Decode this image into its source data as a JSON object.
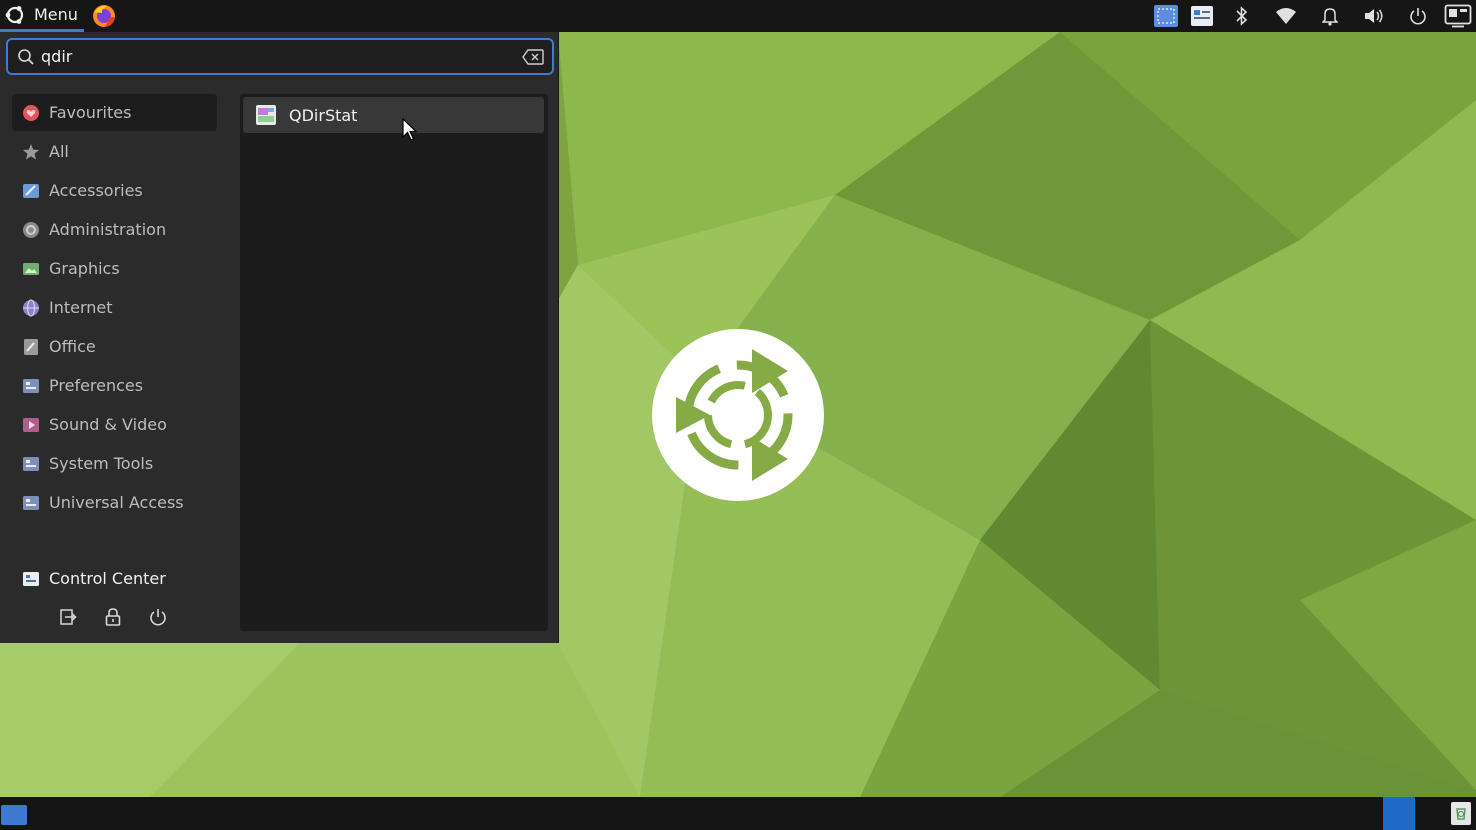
{
  "panel": {
    "menu_label": "Menu",
    "icons": {
      "menu": "ubuntu-mate-icon",
      "launcher": "firefox-icon",
      "tray": [
        "screenshot-icon",
        "control-center-icon",
        "bluetooth-icon",
        "wifi-icon",
        "notification-bell-icon",
        "volume-icon",
        "power-icon",
        "display-icon"
      ]
    }
  },
  "search": {
    "value": "qdir",
    "placeholder": "",
    "icon": "search-icon",
    "clear_icon": "backspace-clear-icon"
  },
  "categories": [
    {
      "label": "Favourites",
      "icon": "heart-icon",
      "color": "#e8525c"
    },
    {
      "label": "All",
      "icon": "star-icon",
      "color": "#9a9a9a"
    },
    {
      "label": "Accessories",
      "icon": "accessories-icon",
      "color": "#6a9bd8"
    },
    {
      "label": "Administration",
      "icon": "administration-icon",
      "color": "#8a8a8a"
    },
    {
      "label": "Graphics",
      "icon": "graphics-icon",
      "color": "#6fae6f"
    },
    {
      "label": "Internet",
      "icon": "internet-globe-icon",
      "color": "#8d82c8"
    },
    {
      "label": "Office",
      "icon": "office-icon",
      "color": "#9a9a9a"
    },
    {
      "label": "Preferences",
      "icon": "preferences-icon",
      "color": "#7f8fb8"
    },
    {
      "label": "Sound & Video",
      "icon": "sound-video-icon",
      "color": "#b05c8c"
    },
    {
      "label": "System Tools",
      "icon": "system-tools-icon",
      "color": "#7f8fb8"
    },
    {
      "label": "Universal Access",
      "icon": "universal-access-icon",
      "color": "#7f8fb8"
    }
  ],
  "control_center": {
    "label": "Control Center",
    "icon": "control-center-icon"
  },
  "session_icons": [
    "logout-icon",
    "lock-icon",
    "shutdown-icon"
  ],
  "results": [
    {
      "label": "QDirStat",
      "icon": "qdirstat-icon"
    }
  ],
  "colors": {
    "accent": "#3c7dd4",
    "panel": "#161616",
    "menu_bg": "#2b2b2b",
    "wallpaper_base": "#86aa45"
  }
}
